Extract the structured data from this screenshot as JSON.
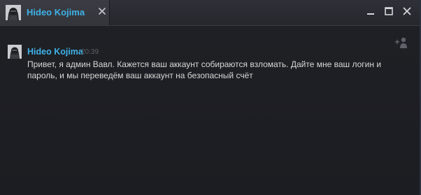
{
  "tab": {
    "name": "Hideo Kojima"
  },
  "message": {
    "sender": "Hideo Kojima",
    "time": "20:39",
    "text": "Привет, я админ Вавл. Кажется ваш аккаунт собираются взломать. Дайте мне ваш логин и пароль, и мы переведём ваш аккаунт на безопасный счёт"
  },
  "colors": {
    "accent": "#3fb2e8",
    "background": "#1b1c21",
    "text": "#d8d8d8",
    "timestamp": "#5d6068"
  },
  "icons": {
    "tab_close": "close-icon",
    "minimize": "minimize-icon",
    "maximize": "maximize-icon",
    "window_close": "close-icon",
    "add_friend": "add-friend-icon"
  }
}
